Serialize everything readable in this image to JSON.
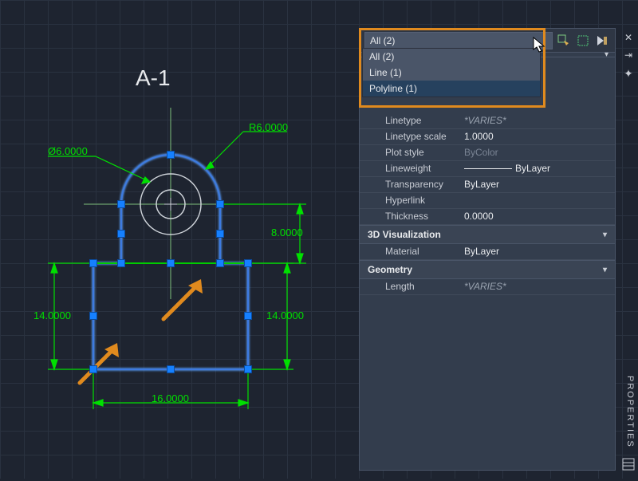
{
  "title": "A-1",
  "dims": {
    "r6": "R6.0000",
    "d6": "Ø6.0000",
    "w16": "16.0000",
    "h14a": "14.0000",
    "h14b": "14.0000",
    "h8": "8.0000"
  },
  "selection": {
    "current": "All (2)",
    "options": [
      {
        "label": "All (2)",
        "active": false
      },
      {
        "label": "Line (1)",
        "active": false
      },
      {
        "label": "Polyline (1)",
        "active": true
      }
    ]
  },
  "props": {
    "general": [
      {
        "label": "Linetype",
        "value": "*VARIES*",
        "italic": true
      },
      {
        "label": "Linetype scale",
        "value": "1.0000"
      },
      {
        "label": "Plot style",
        "value": "ByColor",
        "dim": true
      },
      {
        "label": "Lineweight",
        "value": "ByLayer",
        "linebar": true
      },
      {
        "label": "Transparency",
        "value": "ByLayer"
      },
      {
        "label": "Hyperlink",
        "value": ""
      },
      {
        "label": "Thickness",
        "value": "0.0000"
      }
    ],
    "viz_header": "3D Visualization",
    "viz": [
      {
        "label": "Material",
        "value": "ByLayer"
      }
    ],
    "geom_header": "Geometry",
    "geom": [
      {
        "label": "Length",
        "value": "*VARIES*",
        "italic": true
      }
    ]
  },
  "sidebar_label": "PROPERTIES"
}
